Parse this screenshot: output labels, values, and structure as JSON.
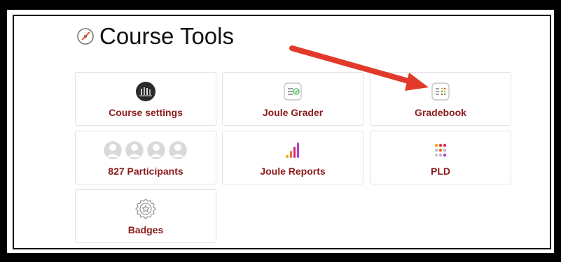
{
  "header": {
    "title": "Course Tools",
    "icon": "gauge-icon"
  },
  "tiles": [
    {
      "label": "Course settings",
      "icon": "course-photo-icon"
    },
    {
      "label": "Joule Grader",
      "icon": "grader-check-icon"
    },
    {
      "label": "Gradebook",
      "icon": "gradebook-grid-icon"
    },
    {
      "label": "827 Participants",
      "icon": "participants-avatars-icon"
    },
    {
      "label": "Joule Reports",
      "icon": "bar-chart-icon"
    },
    {
      "label": "PLD",
      "icon": "dot-matrix-icon"
    },
    {
      "label": "Badges",
      "icon": "badge-star-icon"
    }
  ],
  "colors": {
    "label": "#8a1b1b",
    "arrow": "#e23a2a",
    "tile_border": "#e2e2e2"
  }
}
